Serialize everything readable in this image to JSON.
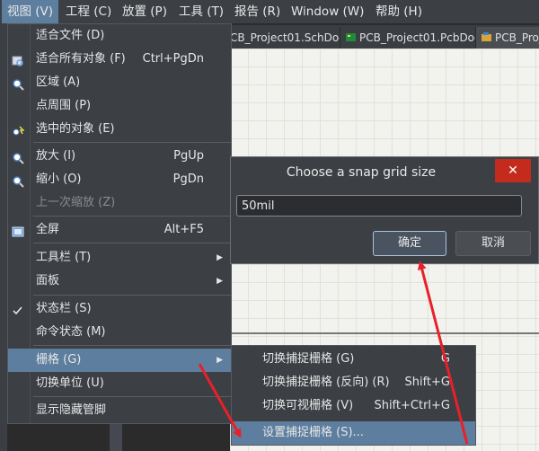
{
  "menubar": {
    "items": [
      {
        "label": "视图 (V)",
        "active": true
      },
      {
        "label": "工程 (C)"
      },
      {
        "label": "放置 (P)"
      },
      {
        "label": "工具 (T)"
      },
      {
        "label": "报告 (R)"
      },
      {
        "label": "Window (W)"
      },
      {
        "label": "帮助 (H)"
      }
    ]
  },
  "tabs": [
    {
      "label": "CB_Project01.SchDoc"
    },
    {
      "label": "PCB_Project01.PcbDoc"
    },
    {
      "label": "PCB_Proje"
    }
  ],
  "view_menu": {
    "items": {
      "fit_document": {
        "label": "适合文件 (D)"
      },
      "fit_all_objects": {
        "label": "适合所有对象 (F)",
        "shortcut": "Ctrl+PgDn"
      },
      "area": {
        "label": "区域 (A)"
      },
      "around_point": {
        "label": "点周围 (P)"
      },
      "selected_objects": {
        "label": "选中的对象 (E)"
      },
      "zoom_in": {
        "label": "放大 (I)",
        "shortcut": "PgUp"
      },
      "zoom_out": {
        "label": "缩小 (O)",
        "shortcut": "PgDn"
      },
      "zoom_last": {
        "label": "上一次缩放 (Z)"
      },
      "full_screen": {
        "label": "全屏",
        "shortcut": "Alt+F5"
      },
      "toolbars": {
        "label": "工具栏 (T)"
      },
      "panels": {
        "label": "面板"
      },
      "status_bar": {
        "label": "状态栏 (S)"
      },
      "command_status": {
        "label": "命令状态 (M)"
      },
      "grids": {
        "label": "栅格 (G)"
      },
      "toggle_units": {
        "label": "切换单位 (U)"
      },
      "show_hidden": {
        "label": "显示隐藏管脚"
      }
    }
  },
  "grid_submenu": {
    "items": [
      {
        "label": "切换捕捉栅格 (G)",
        "shortcut": "G"
      },
      {
        "label": "切换捕捉栅格 (反向) (R)",
        "shortcut": "Shift+G"
      },
      {
        "label": "切换可视栅格 (V)",
        "shortcut": "Shift+Ctrl+G"
      },
      {
        "label": "设置捕捉栅格 (S)..."
      }
    ]
  },
  "dialog": {
    "title": "Choose a snap grid size",
    "close": "✕",
    "value": "50mil",
    "ok": "确定",
    "cancel": "取消"
  },
  "colors": {
    "highlight": "#5d7e9f",
    "menu_bg": "#3c3f44",
    "arrow": "#e8202a",
    "close_bg": "#c42b1c"
  }
}
